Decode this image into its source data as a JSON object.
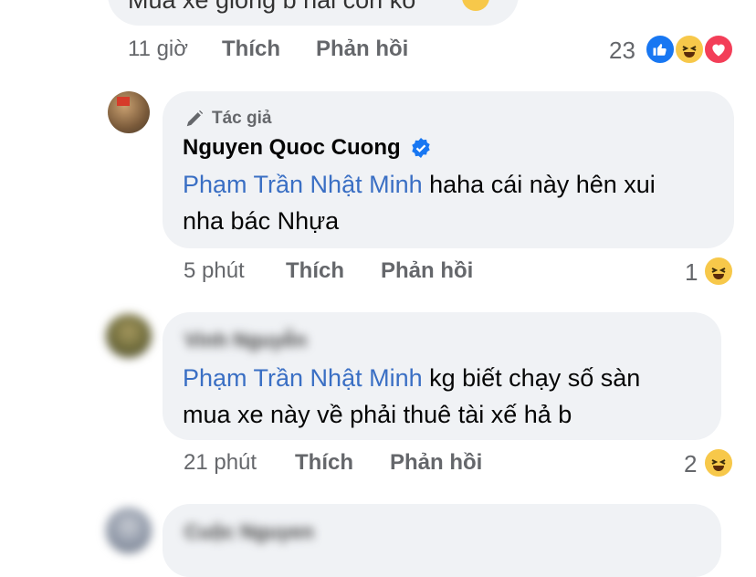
{
  "comment_top": {
    "text": "Mua xe giống b hài còn kô",
    "time": "11 giờ",
    "like": "Thích",
    "reply": "Phản hồi",
    "reaction_count": "23",
    "reactions": [
      "like-icon",
      "haha-icon",
      "love-icon"
    ]
  },
  "reply_author": {
    "badge": "Tác giả",
    "name": "Nguyen Quoc Cuong",
    "mention": "Phạm Trần Nhật Minh",
    "text_line1": " haha cái này hên xui",
    "text_line2": "nha bác Nhựa",
    "time": "5 phút",
    "like": "Thích",
    "reply": "Phản hồi",
    "reaction_count": "1",
    "reactions": [
      "haha-icon"
    ]
  },
  "reply_2": {
    "name": "Vinh Nguyễn",
    "mention": "Phạm Trần Nhật Minh",
    "text_line1": " kg biết chạy số sàn",
    "text_line2": "mua xe này về phải thuê tài xế hả b",
    "time": "21 phút",
    "like": "Thích",
    "reply": "Phản hồi",
    "reaction_count": "2",
    "reactions": [
      "haha-icon"
    ]
  },
  "reply_3": {
    "name": "Cuộc Nguyen"
  },
  "colors": {
    "bubble": "#f0f2f5",
    "mention": "#3a6fc4",
    "meta": "#65676b",
    "verified": "#1877f2"
  }
}
